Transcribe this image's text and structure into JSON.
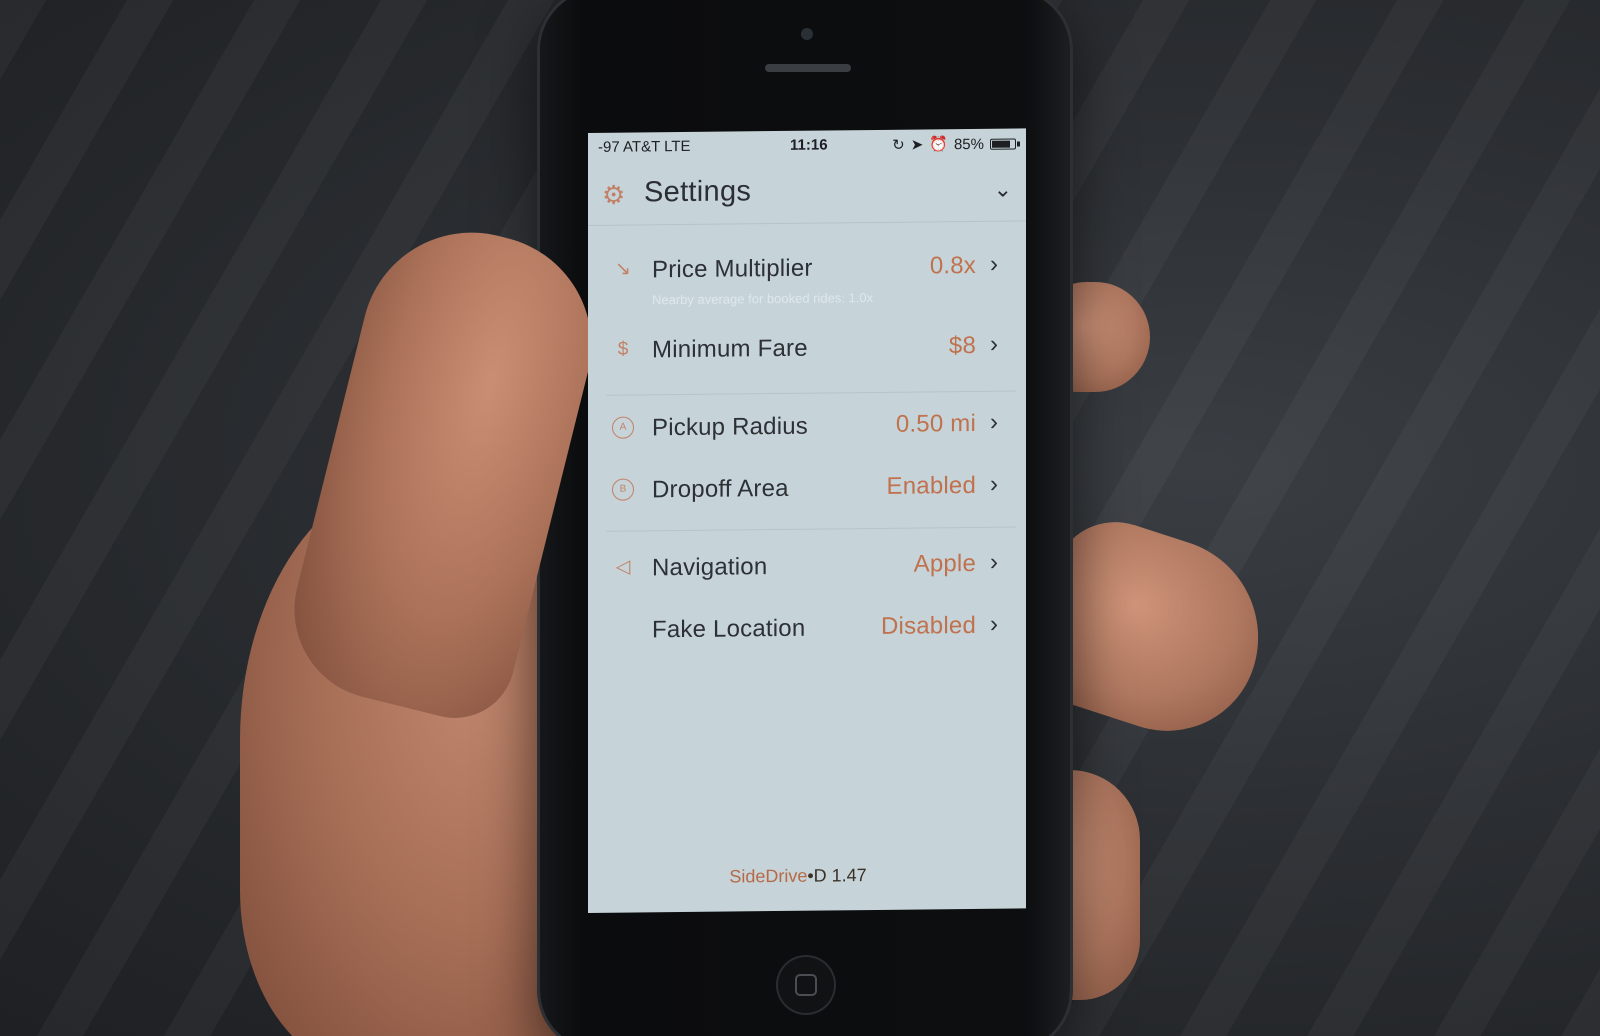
{
  "status_bar": {
    "carrier": "-97 AT&T  LTE",
    "time": "11:16",
    "battery": "85%",
    "battery_level": 0.85,
    "icons": [
      "rotation-lock-icon",
      "location-arrow-icon",
      "alarm-icon"
    ]
  },
  "header": {
    "icon": "gears-icon",
    "title": "Settings",
    "chevron": "chevron-down-icon"
  },
  "settings": {
    "price_multiplier": {
      "label": "Price Multiplier",
      "value": "0.8x",
      "sub": "Nearby average for booked rides: 1.0x",
      "icon": "price-tag-icon"
    },
    "minimum_fare": {
      "label": "Minimum Fare",
      "value": "$8",
      "icon": "dollar-icon"
    },
    "pickup_radius": {
      "label": "Pickup Radius",
      "value": "0.50 mi",
      "icon": "pickup-circle-icon"
    },
    "dropoff_area": {
      "label": "Dropoff Area",
      "value": "Enabled",
      "icon": "dropoff-circle-icon"
    },
    "navigation": {
      "label": "Navigation",
      "value": "Apple",
      "icon": "navigation-arrow-icon"
    },
    "fake_location": {
      "label": "Fake Location",
      "value": "Disabled"
    }
  },
  "footer": {
    "app_name": "SideDrive",
    "version": "•D 1.47"
  },
  "colors": {
    "accent": "#c0724e",
    "screen_bg": "#c6d3d8",
    "text": "#2d3035"
  }
}
